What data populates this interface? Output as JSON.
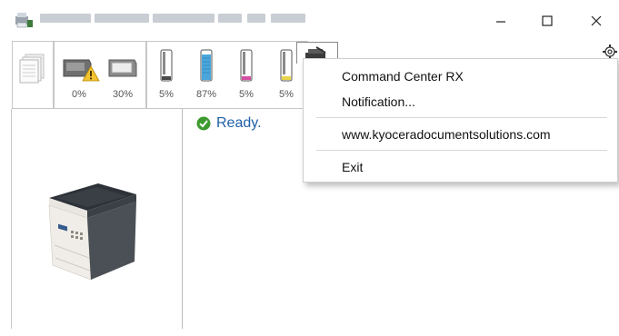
{
  "window": {
    "title_blurred": true,
    "controls": {
      "minimize": "–",
      "maximize": "☐",
      "close": "✕"
    }
  },
  "toolbar": {
    "tray_levels": [
      "0%",
      "30%"
    ],
    "toner_levels": [
      "5%",
      "87%",
      "5%",
      "5%"
    ],
    "tray_warning": true
  },
  "status": {
    "text": "Ready."
  },
  "menu": {
    "items": [
      "Command Center RX",
      "Notification...",
      "www.kyoceradocumentsolutions.com",
      "Exit"
    ]
  },
  "colors": {
    "status_text": "#1f5fa8",
    "ok_check": "#3d9a2e",
    "toner_black": "#4a4a4a",
    "toner_cyan": "#4aa6dc",
    "toner_magenta": "#d64ea3",
    "toner_yellow": "#e8d44a"
  }
}
